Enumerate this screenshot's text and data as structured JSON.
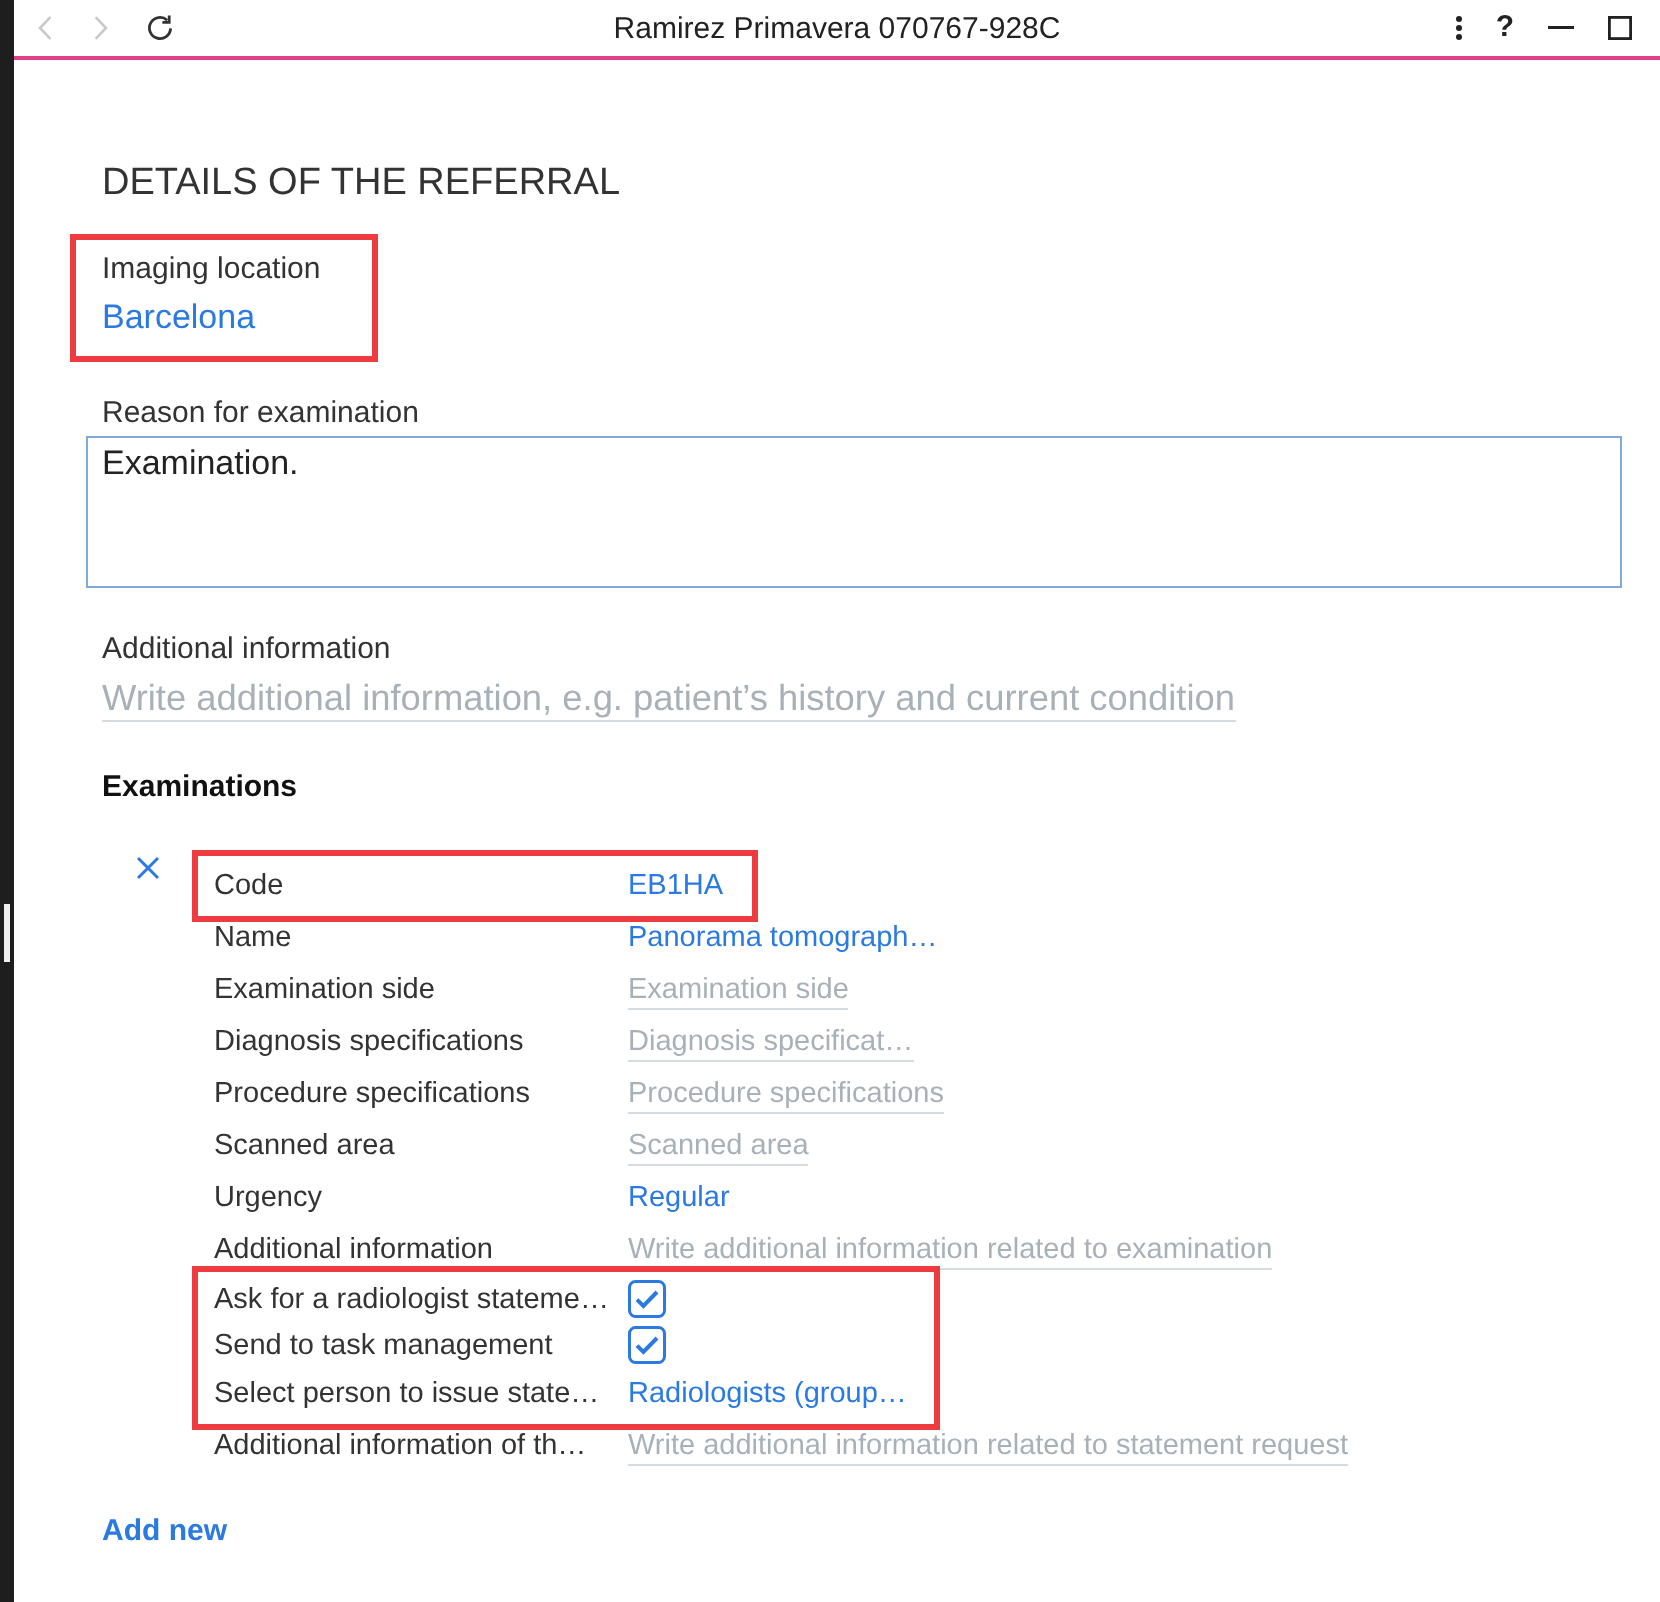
{
  "window": {
    "title": "Ramirez Primavera 070767-928C",
    "nav": [
      {
        "kind": "back",
        "disabled": true
      },
      {
        "kind": "forward",
        "disabled": true
      },
      {
        "kind": "refresh",
        "disabled": false
      }
    ],
    "controls": [
      {
        "kind": "more"
      },
      {
        "kind": "help",
        "label": "?"
      },
      {
        "kind": "minimize"
      },
      {
        "kind": "maximize"
      }
    ]
  },
  "heading": "DETAILS OF THE REFERRAL",
  "imaging_location": {
    "label": "Imaging location",
    "value": "Barcelona",
    "highlighted": true
  },
  "reason": {
    "label": "Reason for examination",
    "value": "Examination."
  },
  "additional_information": {
    "label": "Additional information",
    "placeholder": "Write additional information, e.g. patient’s history and current condition"
  },
  "examinations": {
    "title": "Examinations",
    "items": [
      {
        "rows": [
          {
            "label": "Code",
            "kind": "link",
            "value": "EB1HA",
            "highlighted": true
          },
          {
            "label": "Name",
            "kind": "link",
            "value": "Panorama tomograph…",
            "highlighted": false
          },
          {
            "label": "Examination side",
            "kind": "input",
            "placeholder": "Examination side",
            "highlighted": false
          },
          {
            "label": "Diagnosis specifications",
            "kind": "input",
            "placeholder": "Diagnosis specificat…",
            "highlighted": false
          },
          {
            "label": "Procedure specifications",
            "kind": "input",
            "placeholder": "Procedure specifications",
            "highlighted": false
          },
          {
            "label": "Scanned area",
            "kind": "input",
            "placeholder": "Scanned area",
            "highlighted": false
          },
          {
            "label": "Urgency",
            "kind": "link",
            "value": "Regular",
            "highlighted": false
          },
          {
            "label": "Additional information",
            "kind": "input",
            "placeholder": "Write additional information related to examination",
            "highlighted": false
          },
          {
            "label": "Ask for a radiologist stateme…",
            "kind": "checkbox",
            "checked": true,
            "highlighted": true
          },
          {
            "label": "Send to task management",
            "kind": "checkbox",
            "checked": true,
            "highlighted": true
          },
          {
            "label": "Select person to issue state…",
            "kind": "link",
            "value": "Radiologists (group…",
            "highlighted": true
          },
          {
            "label": "Additional information of th…",
            "kind": "input",
            "placeholder": "Write additional information related to statement request",
            "highlighted": false
          }
        ]
      }
    ],
    "add_label": "Add new"
  }
}
